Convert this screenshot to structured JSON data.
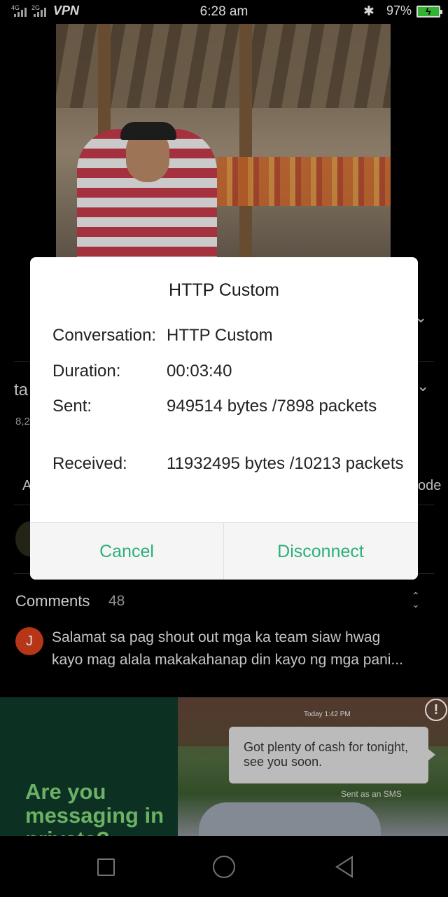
{
  "status_bar": {
    "net1": "4G",
    "net2": "2G",
    "vpn": "VPN",
    "time": "6:28 am",
    "bluetooth_icon": "bluetooth-icon",
    "battery_pct": "97%",
    "battery_color": "#3ad33a"
  },
  "background": {
    "title_peek": "ta",
    "views_peek": "8,2",
    "tab_peek_left": "A",
    "tab_peek_right": "ode",
    "comments": {
      "label": "Comments",
      "count": "48",
      "first": {
        "avatar_letter": "J",
        "line1": "Salamat sa pag shout out mga ka team siaw hwag",
        "line2": "kayo mag alala makakahanap din kayo ng mga pani..."
      }
    },
    "ad": {
      "headline": "Are you messaging in private?",
      "time": "Today 1:42 PM",
      "message": "Got plenty of cash for tonight, see you soon.",
      "sent_note": "Sent as an SMS",
      "info_icon": "info-icon"
    }
  },
  "dialog": {
    "title": "HTTP Custom",
    "rows": [
      {
        "label": "Conversation:",
        "value": "HTTP Custom"
      },
      {
        "label": "Duration:",
        "value": "00:03:40"
      },
      {
        "label": "Sent:",
        "value": "949514 bytes /7898 packets"
      },
      {
        "label": "Received:",
        "value": "11932495 bytes /10213 packets"
      }
    ],
    "cancel_label": "Cancel",
    "disconnect_label": "Disconnect",
    "accent_color": "#2bb07a"
  }
}
